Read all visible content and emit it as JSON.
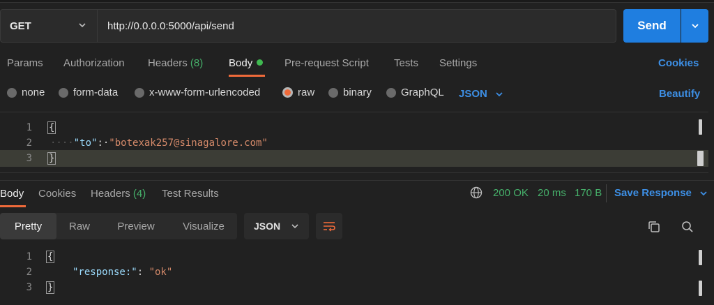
{
  "request": {
    "method": "GET",
    "url": "http://0.0.0.0:5000/api/send",
    "send_label": "Send"
  },
  "req_tabs": {
    "params": "Params",
    "authorization": "Authorization",
    "headers": "Headers",
    "headers_count": "(8)",
    "body": "Body",
    "prerequest": "Pre-request Script",
    "tests": "Tests",
    "settings": "Settings",
    "cookies": "Cookies"
  },
  "body_types": {
    "none": "none",
    "form_data": "form-data",
    "urlencoded": "x-www-form-urlencoded",
    "raw": "raw",
    "binary": "binary",
    "graphql": "GraphQL",
    "selected_format": "JSON",
    "beautify": "Beautify"
  },
  "request_body": {
    "line_numbers": [
      "1",
      "2",
      "3"
    ],
    "open_brace": "{",
    "indent_dots": "····",
    "key": "\"to\"",
    "colon": ":·",
    "value": "\"botexak257@sinagalore.com\"",
    "close_brace": "}"
  },
  "resp_tabs": {
    "body": "Body",
    "cookies": "Cookies",
    "headers": "Headers",
    "headers_count": "(4)",
    "test_results": "Test Results"
  },
  "response_status": {
    "status": "200 OK",
    "time": "20 ms",
    "size": "170 B",
    "save_label": "Save Response"
  },
  "response_view": {
    "pretty": "Pretty",
    "raw": "Raw",
    "preview": "Preview",
    "visualize": "Visualize",
    "format": "JSON"
  },
  "response_body": {
    "line_numbers": [
      "1",
      "2",
      "3"
    ],
    "open_brace": "{",
    "key": "\"response:\"",
    "colon": ": ",
    "value": "\"ok\"",
    "close_brace": "}"
  },
  "colors": {
    "accent_blue": "#1f7ee0",
    "accent_orange": "#ef6a3a",
    "status_green": "#46b06a"
  },
  "icons": [
    "chevron-down-icon",
    "globe-icon",
    "wrap-lines-icon",
    "copy-icon",
    "search-icon"
  ]
}
